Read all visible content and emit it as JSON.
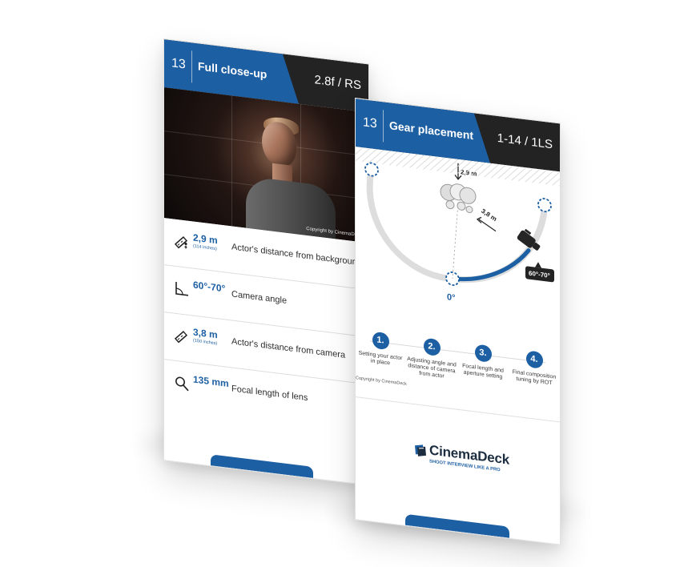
{
  "left_card": {
    "number": "13",
    "title": "Full close-up",
    "meta": "2.8f / RS",
    "photo_copyright": "Copyright by CinemaDeck",
    "specs": [
      {
        "icon": "ruler-actor-icon",
        "value": "2,9 m",
        "subvalue": "(114 inches)",
        "label": "Actor's distance from background"
      },
      {
        "icon": "angle-icon",
        "value": "60°-70°",
        "subvalue": "",
        "label": "Camera angle"
      },
      {
        "icon": "ruler-icon",
        "value": "3,8 m",
        "subvalue": "(150 inches)",
        "label": "Actor's distance from camera"
      },
      {
        "icon": "lens-icon",
        "value": "135 mm",
        "subvalue": "",
        "label": "Focal length of lens"
      }
    ]
  },
  "right_card": {
    "number": "13",
    "title": "Gear placement",
    "meta": "1-14 / 1LS",
    "diagram": {
      "top_distance": "2,9 m",
      "camera_distance": "3,8 m",
      "angle_badge": "60°-70°",
      "zero_label": "0°"
    },
    "steps": [
      {
        "number": "1.",
        "label": "Setting your actor in place"
      },
      {
        "number": "2.",
        "label": "Adjusting angle and distance of camera from actor"
      },
      {
        "number": "3.",
        "label": "Focal length and aperture setting"
      },
      {
        "number": "4.",
        "label": "Final composition tuning by ROT"
      }
    ],
    "copyright": "Copyright by CinemaDeck",
    "logo": {
      "main": "CinemaDeck",
      "sub": "SHOOT INTERVIEW LIKE A PRO"
    }
  },
  "colors": {
    "accent_blue": "#1d5fa3",
    "header_dark": "#232323",
    "text_dark": "#2e2e2e",
    "line_gray": "#dddddd"
  }
}
